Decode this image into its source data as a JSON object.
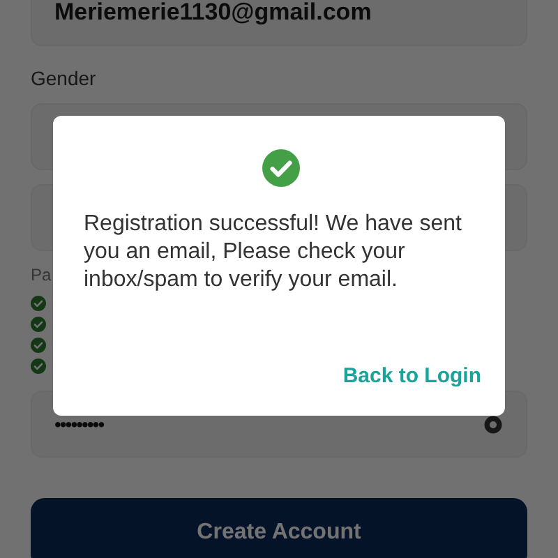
{
  "form": {
    "email_value": "Meriemerie1130@gmail.com",
    "gender_label": "Gender",
    "password_label": "Pa",
    "password_rules": [
      {
        "met": true
      },
      {
        "met": true
      },
      {
        "met": true
      },
      {
        "met": true
      }
    ],
    "password_value": "•••••••••",
    "submit": "Create Account"
  },
  "dialog": {
    "message": "Registration successful! We have sent you an email, Please check your inbox/spam to verify your email.",
    "action": "Back to Login"
  }
}
